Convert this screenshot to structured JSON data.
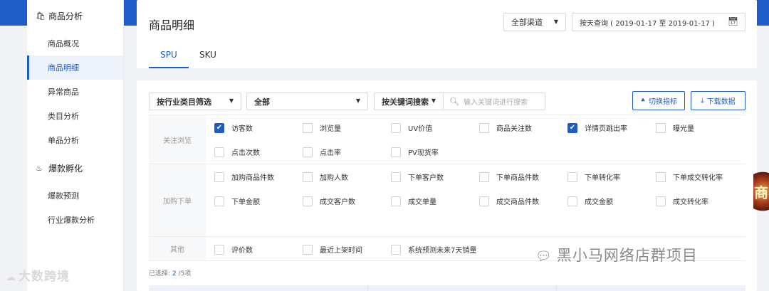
{
  "sidebar": {
    "sections": [
      {
        "icon": "shopping-bag-icon",
        "label": "商品分析",
        "items": [
          "商品概况",
          "商品明细",
          "异常商品",
          "类目分析",
          "单品分析"
        ]
      },
      {
        "icon": "fire-icon",
        "label": "爆款孵化",
        "items": [
          "爆款预测",
          "行业爆款分析"
        ]
      }
    ],
    "active_item": "商品明细"
  },
  "header": {
    "title": "商品明细",
    "channel_select": "全部渠道",
    "date_range": "按天查询 ( 2019-01-17 至 2019-01-17 )",
    "tabs": [
      {
        "label": "SPU",
        "active": true
      },
      {
        "label": "SKU",
        "active": false
      }
    ]
  },
  "filters": {
    "industry_filter": "按行业类目筛选",
    "category_value": "全部",
    "keyword_mode": "按关键词搜索",
    "search_placeholder": "输入关键词进行搜索",
    "switch_metrics_label": "切换指标",
    "download_label": "下载数据"
  },
  "metric_groups": [
    {
      "name": "关注浏览",
      "metrics": [
        {
          "label": "访客数",
          "checked": true
        },
        {
          "label": "浏览量",
          "checked": false
        },
        {
          "label": "UV价值",
          "checked": false
        },
        {
          "label": "商品关注数",
          "checked": false
        },
        {
          "label": "详情页跳出率",
          "checked": true
        },
        {
          "label": "曝光量",
          "checked": false
        },
        {
          "label": "点击次数",
          "checked": false
        },
        {
          "label": "点击率",
          "checked": false
        },
        {
          "label": "PV现货率",
          "checked": false
        }
      ]
    },
    {
      "name": "加购下单",
      "metrics": [
        {
          "label": "加购商品件数",
          "checked": false
        },
        {
          "label": "加购人数",
          "checked": false
        },
        {
          "label": "下单客户数",
          "checked": false
        },
        {
          "label": "下单商品件数",
          "checked": false
        },
        {
          "label": "下单转化率",
          "checked": false
        },
        {
          "label": "下单成交转化率",
          "checked": false
        },
        {
          "label": "下单金额",
          "checked": false
        },
        {
          "label": "成交客户数",
          "checked": false
        },
        {
          "label": "成交单量",
          "checked": false
        },
        {
          "label": "成交商品件数",
          "checked": false
        },
        {
          "label": "成交金额",
          "checked": false
        },
        {
          "label": "成交转化率",
          "checked": false
        }
      ]
    },
    {
      "name": "其他",
      "metrics": [
        {
          "label": "评价数",
          "checked": false
        },
        {
          "label": "最近上架时间",
          "checked": false
        },
        {
          "label": "系统预测未来7天销量",
          "checked": false
        }
      ]
    }
  ],
  "selection": {
    "prefix": "已选择:",
    "count": "2",
    "suffix": "/5项"
  },
  "watermarks": {
    "left": "大数跨境",
    "right": "黑小马网络店群项目",
    "edge": "商"
  }
}
